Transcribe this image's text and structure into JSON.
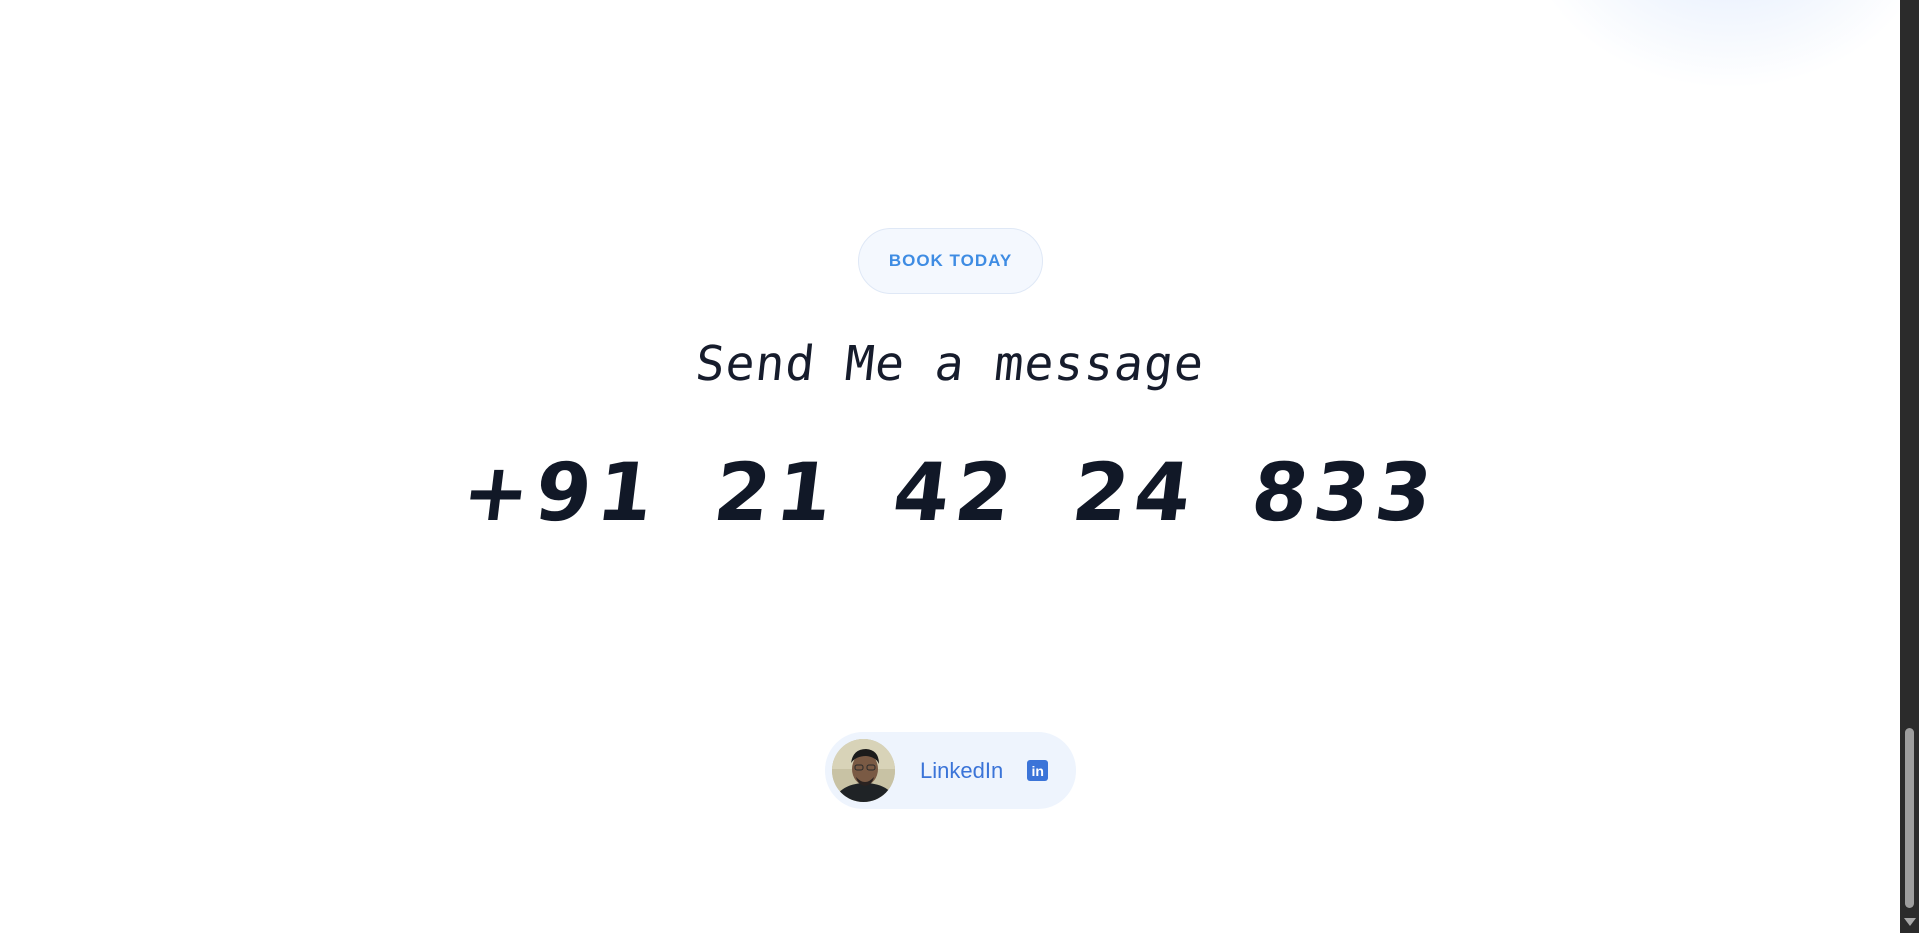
{
  "cta": {
    "book_label": "BOOK TODAY"
  },
  "contact": {
    "heading": "Send Me a message",
    "phone": "+91 21 42 24 833"
  },
  "social": {
    "linkedin_label": "LinkedIn",
    "linkedin_icon_text": "in",
    "icon": "linkedin-icon"
  },
  "colors": {
    "accent": "#3e8ce3",
    "linkedin_blue": "#3b74d8",
    "text_dark": "#111827",
    "pill_bg": "#eef4fd"
  }
}
